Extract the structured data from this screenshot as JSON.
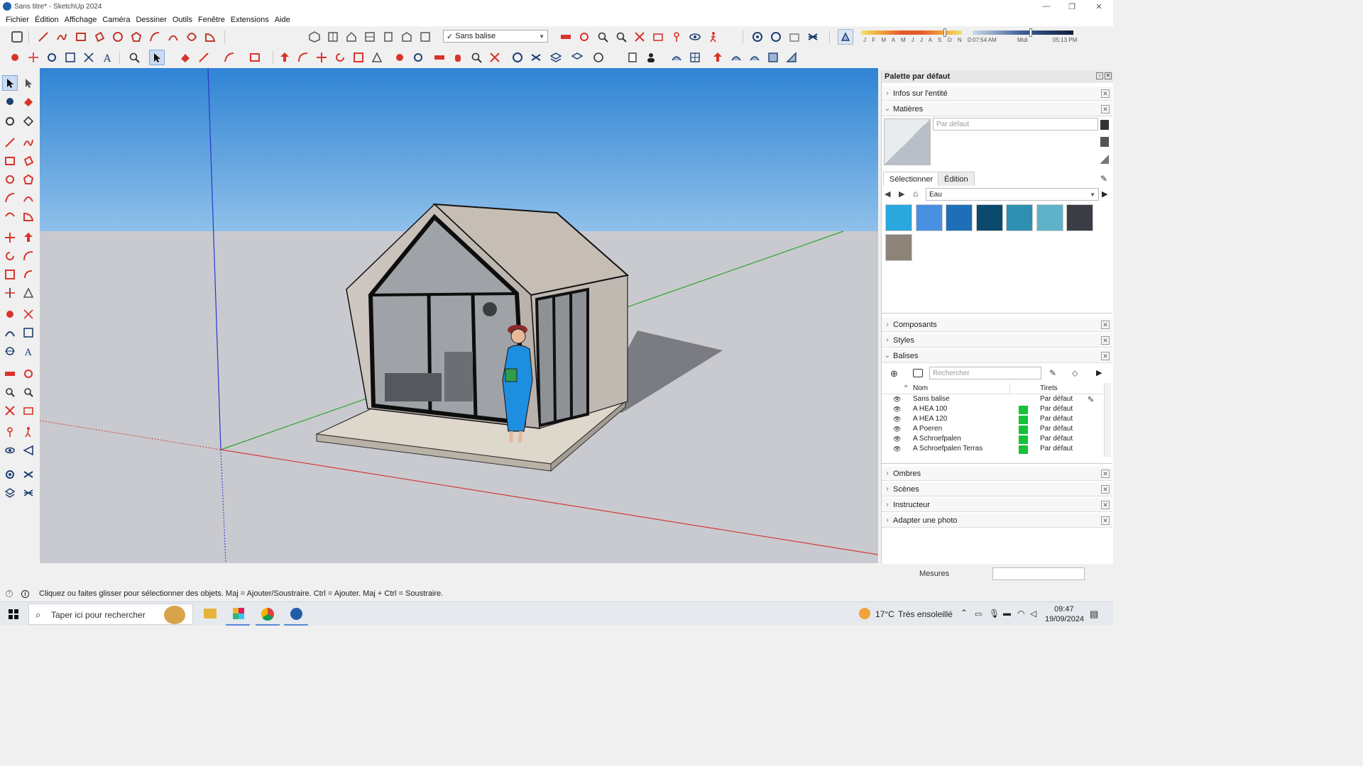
{
  "window": {
    "title": "Sans titre* - SketchUp 2024"
  },
  "menu": [
    "Fichier",
    "Édition",
    "Affichage",
    "Caméra",
    "Dessiner",
    "Outils",
    "Fenêtre",
    "Extensions",
    "Aide"
  ],
  "toolbar": {
    "tag_select": {
      "check": "✓",
      "value": "Sans balise"
    },
    "shadow_months": "J F M A M J J A S O N D",
    "time_start": "07:54 AM",
    "time_mid": "Midi",
    "time_end": "05:13 PM",
    "date_slider_level": 0.83,
    "time_slider_level": 0.58
  },
  "panel": {
    "title": "Palette par défaut",
    "trays_top": [
      "Infos sur l'entité",
      "Matières"
    ],
    "materials": {
      "name_placeholder": "Par défaut",
      "tab_select": "Sélectionner",
      "tab_edit": "Édition",
      "collection": "Eau",
      "swatch_colors": [
        "#2aa7dd",
        "#4a90e2",
        "#1e6fb8",
        "#0b4a6e",
        "#2f8fb0",
        "#5fb3c9",
        "#3a3d44",
        "#8c8478"
      ]
    },
    "trays_middle": [
      "Composants",
      "Styles",
      "Balises"
    ],
    "tags": {
      "search_placeholder": "Rechercher",
      "col_name": "Nom",
      "col_dashes": "Tirets",
      "rows": [
        {
          "name": "Sans balise",
          "dashes": "Par défaut",
          "color": ""
        },
        {
          "name": "A HEA 100",
          "dashes": "Par défaut",
          "color": "#16c23a"
        },
        {
          "name": "A HEA 120",
          "dashes": "Par défaut",
          "color": "#16c23a"
        },
        {
          "name": "A Poeren",
          "dashes": "Par défaut",
          "color": "#16c23a"
        },
        {
          "name": "A Schroefpalen",
          "dashes": "Par défaut",
          "color": "#16c23a"
        },
        {
          "name": "A Schroefpalen Terras",
          "dashes": "Par défaut",
          "color": "#16c23a"
        }
      ]
    },
    "trays_bottom": [
      "Ombres",
      "Scènes",
      "Instructeur",
      "Adapter une photo"
    ]
  },
  "measures_label": "Mesures",
  "status_text": "Cliquez ou faites glisser pour sélectionner des objets. Maj = Ajouter/Soustraire. Ctrl = Ajouter. Maj + Ctrl = Soustraire.",
  "taskbar": {
    "search_placeholder": "Taper ici pour rechercher",
    "weather_temp": "17°C",
    "weather_text": "Très ensoleillé",
    "time": "09:47",
    "date": "19/09/2024"
  },
  "colors": {
    "sky": "#3a8fd8",
    "ground": "#c9cacf",
    "accent": "#1f5fa8",
    "tag_green": "#16c23a"
  }
}
